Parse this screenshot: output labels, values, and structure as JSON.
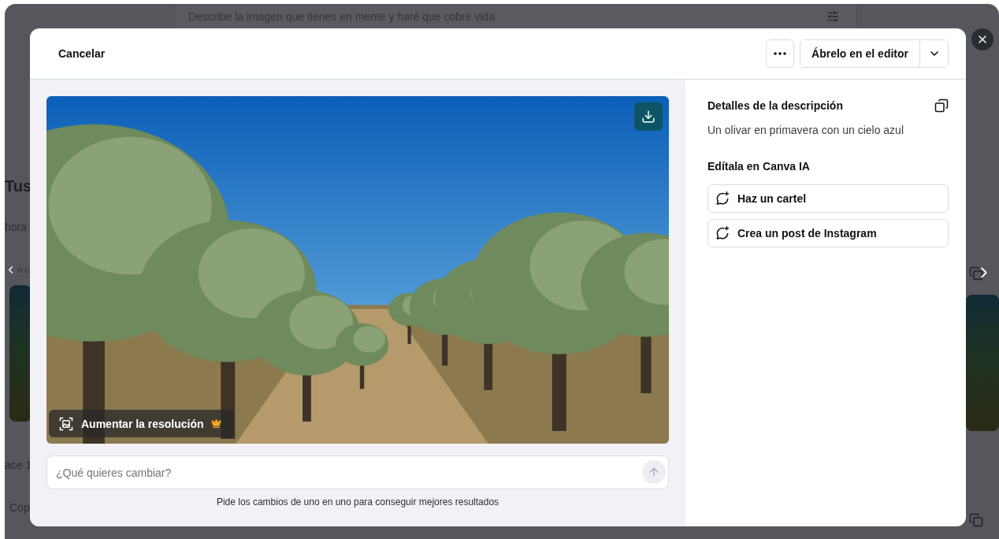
{
  "background_page": {
    "search_placeholder": "Describe la imagen que tienes en mente y haré que cobre vida",
    "heading": "Tus",
    "left_texts": [
      "hora",
      "n c"
    ],
    "lower_texts": [
      "ace 1",
      "Cop"
    ]
  },
  "dialog": {
    "cancel": "Cancelar",
    "open_editor": "Ábrelo en el editor",
    "upscale": "Aumentar la resolución",
    "prompt_placeholder": "¿Qué quieres cambiar?",
    "hint": "Pide los cambios de uno en uno para conseguir mejores resultados",
    "details_title": "Detalles de la descripción",
    "description": "Un olivar en primavera con un cielo azul",
    "edit_title": "Edítala en Canva IA",
    "actions": [
      "Haz un cartel",
      "Crea un post de Instagram"
    ]
  }
}
